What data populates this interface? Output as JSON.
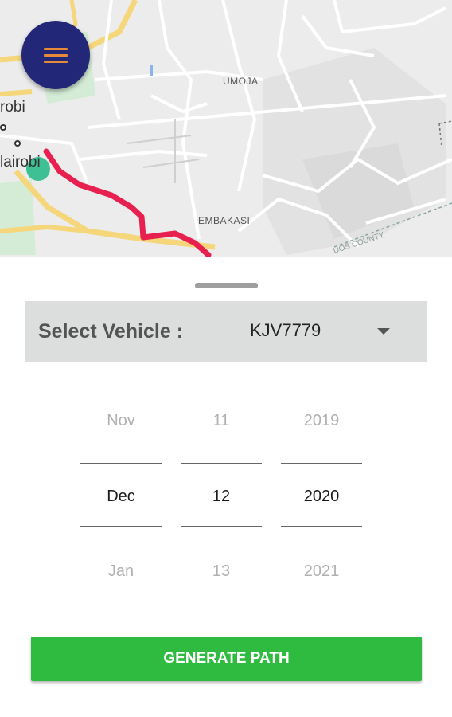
{
  "map": {
    "labels": {
      "umoja": "UMOJA",
      "embakasi": "EMBAKASI",
      "county": "UOS COUNTY",
      "city_top": "robi",
      "city_bottom": "lairobi"
    },
    "colors": {
      "route": "#e8204f",
      "fab": "#232777",
      "fab_icon": "#e6893a"
    },
    "menu_icon": "hamburger-menu-icon"
  },
  "vehicle": {
    "label": "Select Vehicle :",
    "value": "KJV7779",
    "dropdown_icon": "caret-down-icon"
  },
  "date_picker": {
    "month": {
      "prev": "Nov",
      "selected": "Dec",
      "next": "Jan"
    },
    "day": {
      "prev": "11",
      "selected": "12",
      "next": "13"
    },
    "year": {
      "prev": "2019",
      "selected": "2020",
      "next": "2021"
    }
  },
  "actions": {
    "generate_label": "GENERATE PATH",
    "generate_color": "#2fbb3f"
  }
}
